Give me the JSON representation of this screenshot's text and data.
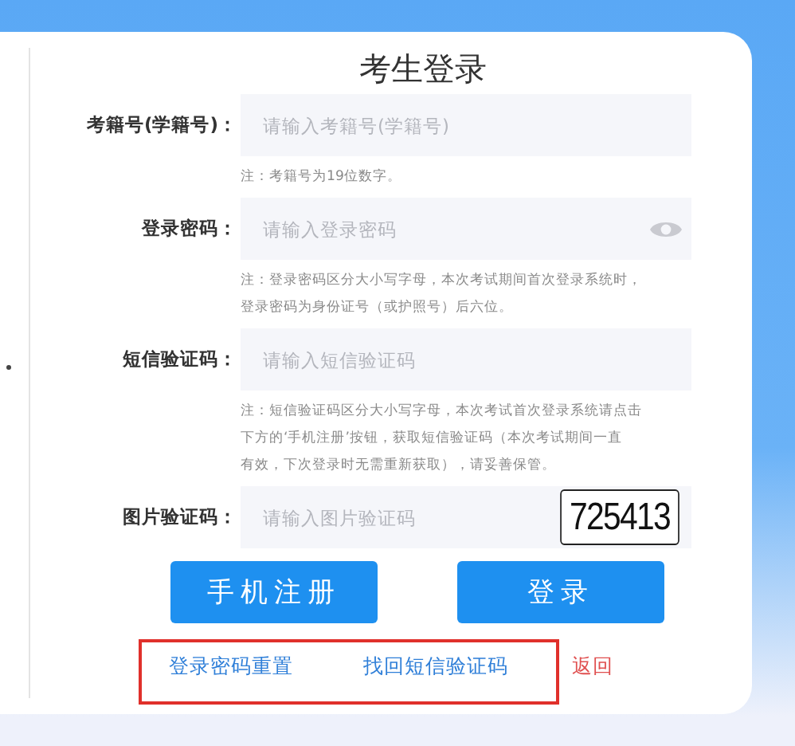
{
  "title": "考生登录",
  "fields": [
    {
      "label": "考籍号(学籍号)：",
      "placeholder": "请输入考籍号(学籍号)",
      "kind": "text",
      "notes": [
        "注：考籍号为19位数字。"
      ]
    },
    {
      "label": "登录密码：",
      "placeholder": "请输入登录密码",
      "kind": "password",
      "notes": [
        "注：登录密码区分大小写字母，本次考试期间首次登录系统时，",
        "登录密码为身份证号（或护照号）后六位。"
      ]
    },
    {
      "label": "短信验证码：",
      "placeholder": "请输入短信验证码",
      "kind": "text",
      "notes": [
        "注：短信验证码区分大小写字母，本次考试首次登录系统请点击",
        "下方的‘手机注册’按钮，获取短信验证码（本次考试期间一直",
        "有效，下次登录时无需重新获取），请妥善保管。"
      ]
    },
    {
      "label": "图片验证码：",
      "placeholder": "请输入图片验证码",
      "kind": "captcha",
      "captcha": "725413"
    }
  ],
  "buttons": [
    "手机注册",
    "登录"
  ],
  "links": [
    {
      "label": "登录密码重置",
      "kind": "boxed"
    },
    {
      "label": "找回短信验证码",
      "kind": "boxed"
    },
    {
      "label": "返回",
      "kind": "back"
    }
  ]
}
